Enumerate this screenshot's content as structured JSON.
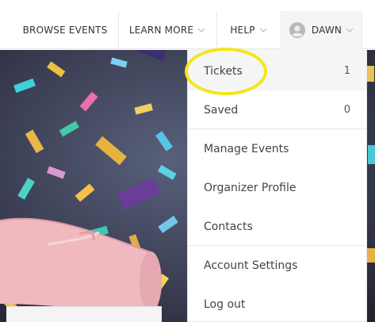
{
  "nav": {
    "browse_label": "BROWSE EVENTS",
    "learn_label": "LEARN MORE",
    "help_label": "HELP",
    "user_label": "DAWN"
  },
  "dropdown": {
    "items": [
      {
        "label": "Tickets",
        "count": "1"
      },
      {
        "label": "Saved",
        "count": "0"
      },
      {
        "label": "Manage Events"
      },
      {
        "label": "Organizer Profile"
      },
      {
        "label": "Contacts"
      },
      {
        "label": "Account Settings"
      },
      {
        "label": "Log out"
      }
    ]
  },
  "colors": {
    "highlight": "#f5e51a",
    "active_bg": "#f5f5f5",
    "text": "#444444"
  },
  "icons": {
    "chevron": "chevron-down-icon",
    "avatar": "user-avatar-icon"
  }
}
